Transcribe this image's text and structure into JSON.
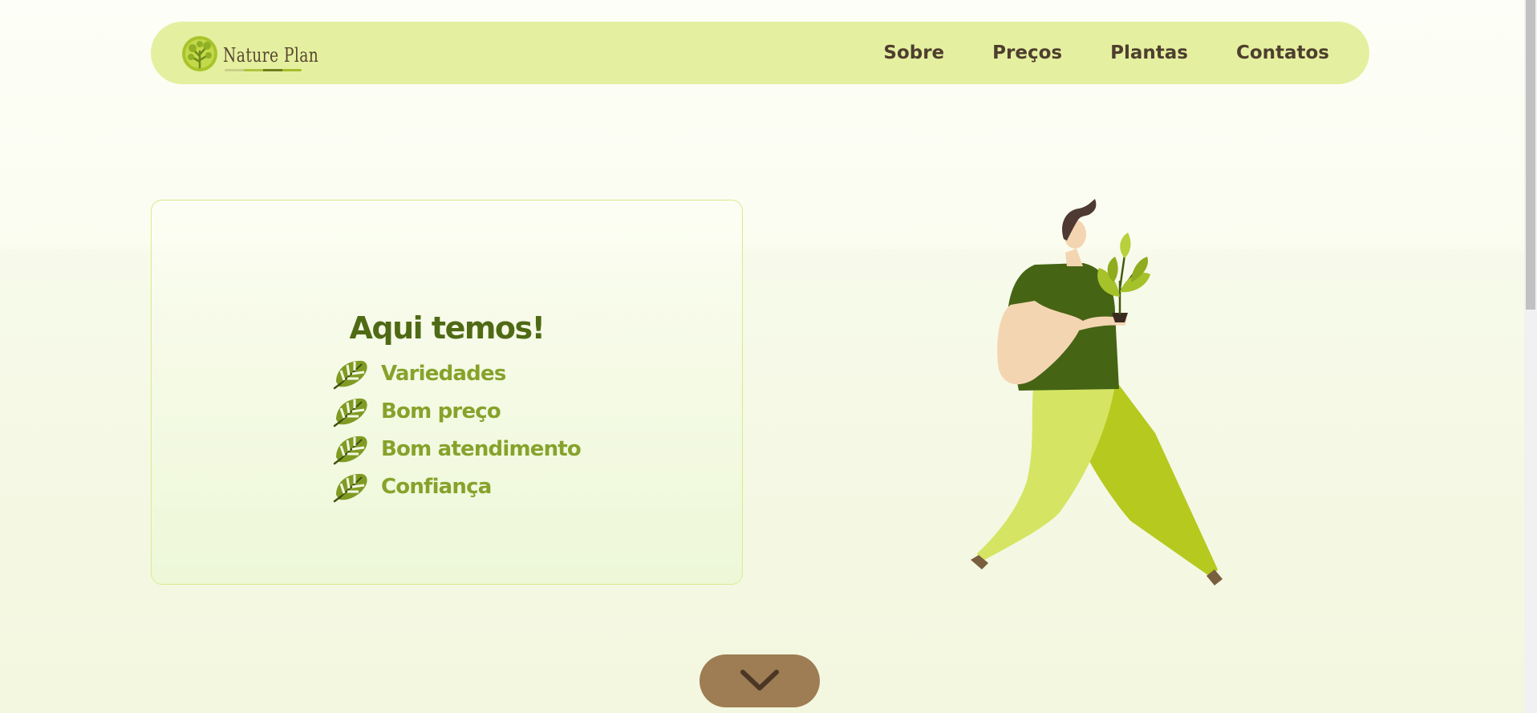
{
  "header": {
    "logo_text": "Nature Plan",
    "nav": [
      "Sobre",
      "Preços",
      "Plantas",
      "Contatos"
    ]
  },
  "card": {
    "title": "Aqui temos!",
    "items": [
      "Variedades",
      "Bom preço",
      "Bom atendimento",
      "Confiança"
    ]
  },
  "icons": {
    "logo": "tree-logo-icon",
    "list": "monstera-leaf-icon",
    "scroll": "chevron-down-icon"
  },
  "colors": {
    "navbar": "#e4f09f",
    "nav_text": "#4e3e2f",
    "title": "#4f6a14",
    "list_text": "#87a22b",
    "scroll_button": "#9e7c54",
    "card_border": "#dbea8c"
  }
}
